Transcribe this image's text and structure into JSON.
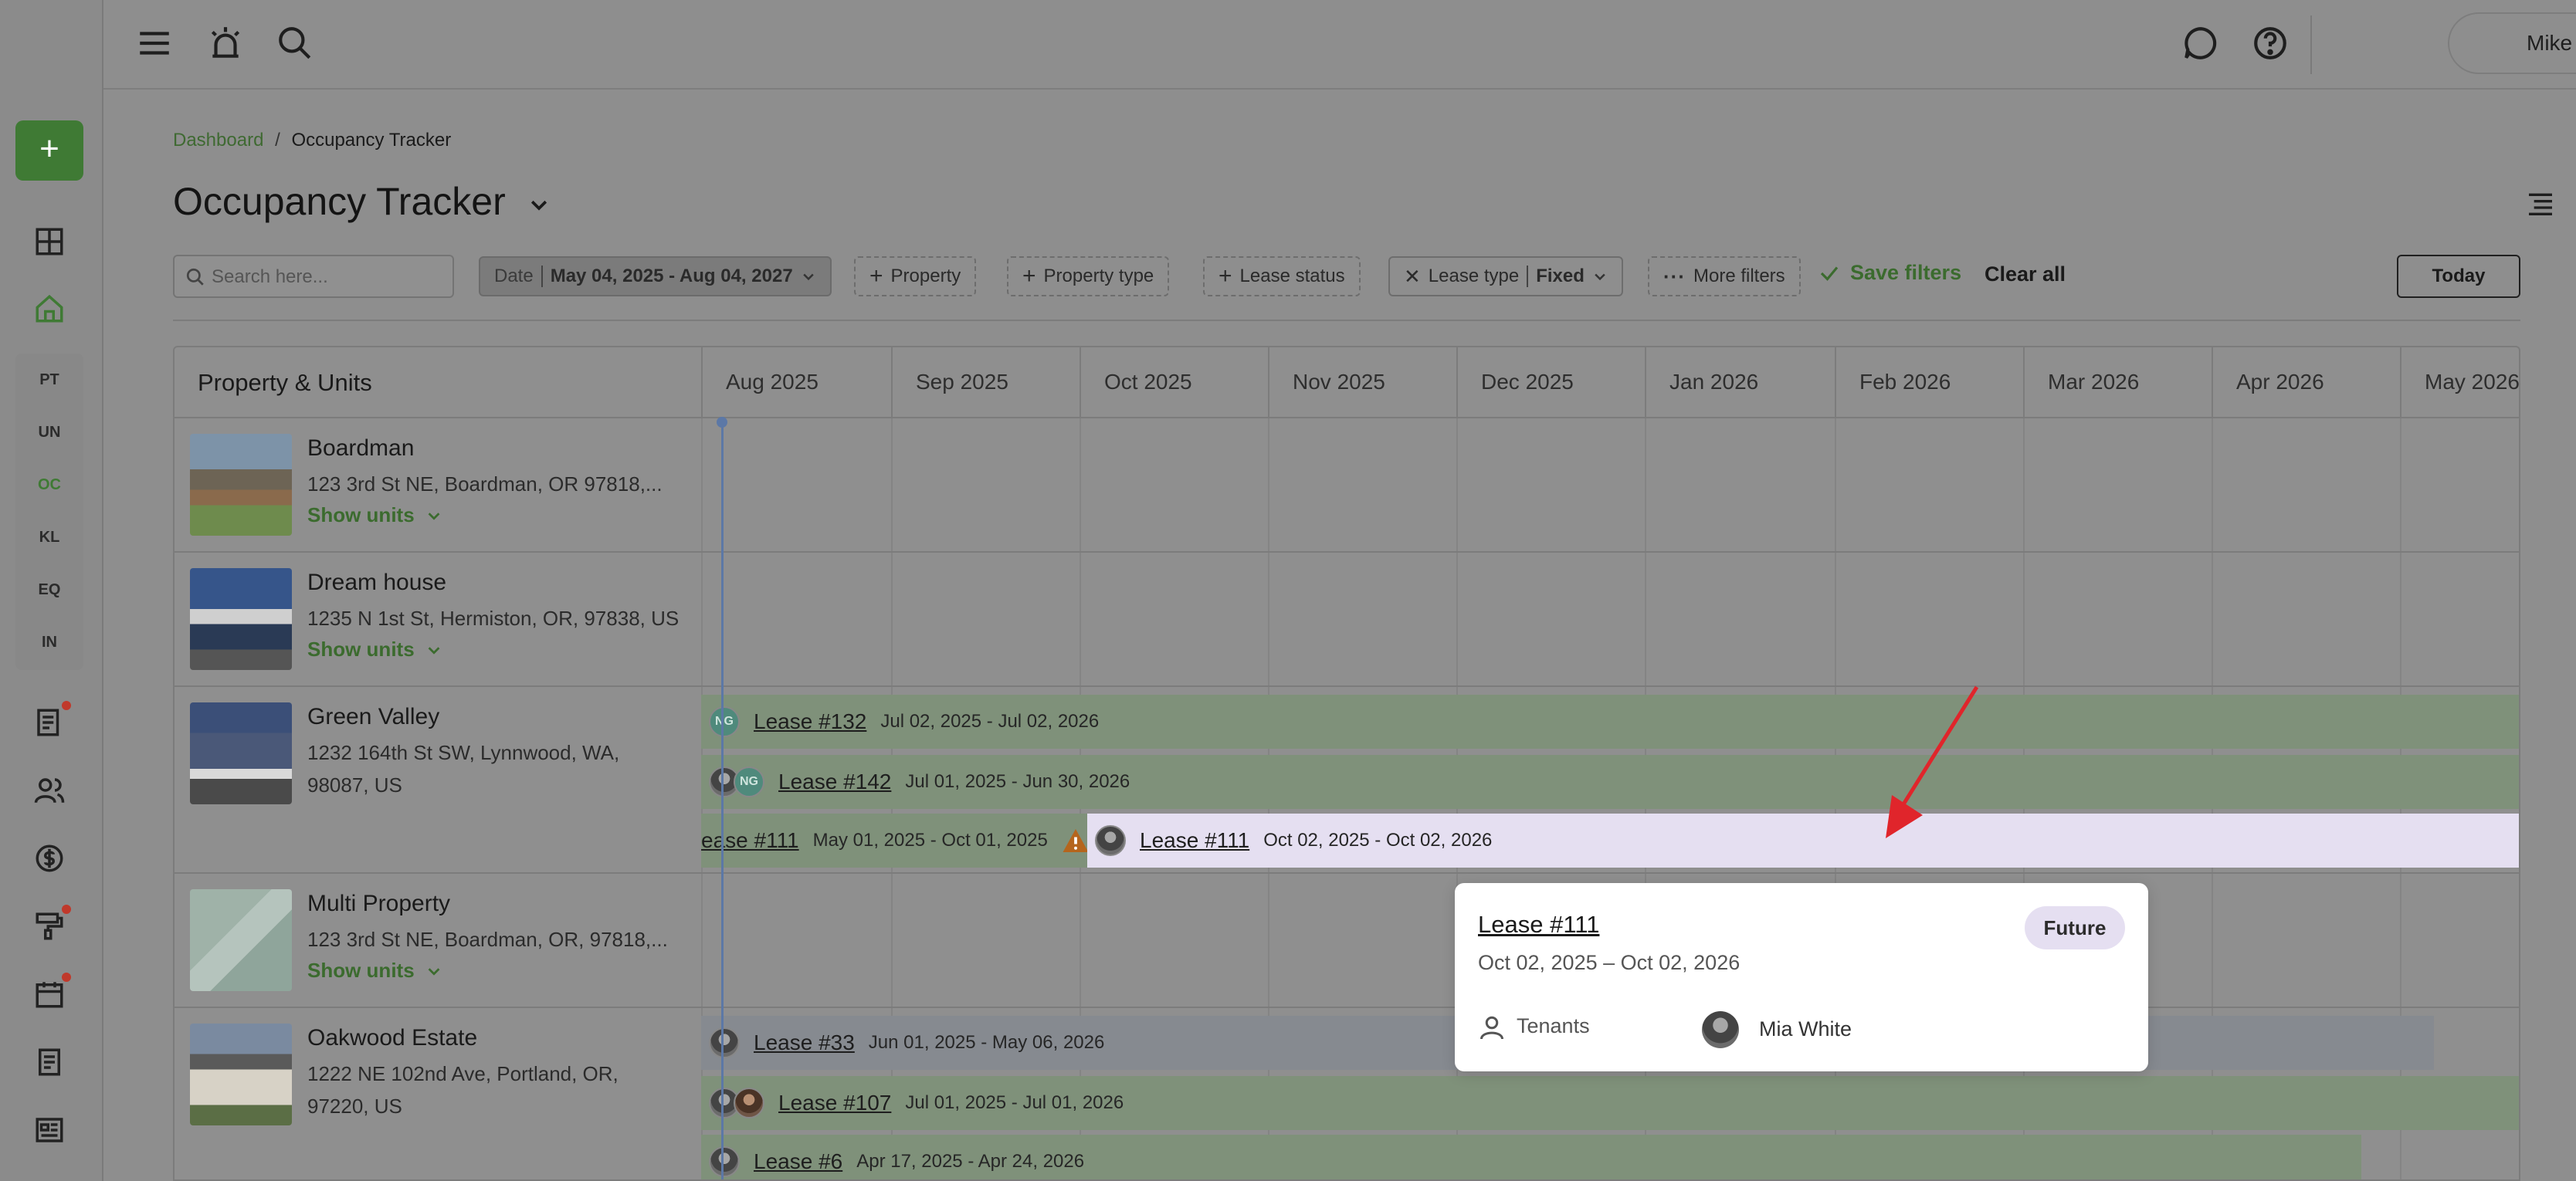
{
  "nav": {
    "add_label": "+",
    "abbrevs": [
      "PT",
      "UN",
      "OC",
      "KL",
      "EQ",
      "IN"
    ],
    "active_abbrev": "OC"
  },
  "topbar": {
    "user_name": "Mike"
  },
  "breadcrumb": {
    "home": "Dashboard",
    "separator": "/",
    "current": "Occupancy Tracker"
  },
  "page": {
    "title": "Occupancy Tracker"
  },
  "filters": {
    "search_placeholder": "Search here...",
    "date_label": "Date",
    "date_value": "May 04, 2025 - Aug 04, 2027",
    "property": "Property",
    "property_type": "Property type",
    "lease_status": "Lease status",
    "lease_type_label": "Lease type",
    "lease_type_value": "Fixed",
    "more_filters": "More filters",
    "save_filters": "Save filters",
    "clear_all": "Clear all",
    "today": "Today"
  },
  "grid": {
    "header": "Property & Units",
    "months": [
      "Aug 2025",
      "Sep 2025",
      "Oct 2025",
      "Nov 2025",
      "Dec 2025",
      "Jan 2026",
      "Feb 2026",
      "Mar 2026",
      "Apr 2026",
      "May 2026"
    ],
    "show_units": "Show units",
    "properties": [
      {
        "name": "Boardman",
        "address": "123 3rd St NE, Boardman, OR 97818,..."
      },
      {
        "name": "Dream house",
        "address": "1235 N 1st St, Hermiston, OR, 97838, US"
      },
      {
        "name": "Green Valley",
        "address_l1": "1232 164th St SW, Lynnwood, WA,",
        "address_l2": "98087, US"
      },
      {
        "name": "Multi Property",
        "address": "123 3rd St NE, Boardman, OR, 97818,..."
      },
      {
        "name": "Oakwood Estate",
        "address_l1": "1222 NE 102nd Ave, Portland, OR,",
        "address_l2": "97220, US"
      }
    ],
    "leases": {
      "l132": {
        "name": "Lease #132",
        "dates": "Jul 02, 2025 - Jul 02, 2026",
        "initials": "NG"
      },
      "l142": {
        "name": "Lease #142",
        "dates": "Jul 01, 2025 - Jun 30, 2026",
        "initials": "NG"
      },
      "l111a": {
        "name": "ease #111",
        "dates": "May 01, 2025 - Oct 01, 2025"
      },
      "l111b": {
        "name": "Lease #111",
        "dates": "Oct 02, 2025 - Oct 02, 2026"
      },
      "l33": {
        "name": "Lease #33",
        "dates": "Jun 01, 2025 - May 06, 2026"
      },
      "l107": {
        "name": "Lease #107",
        "dates": "Jul 01, 2025 - Jul 01, 2026"
      },
      "l6": {
        "name": "Lease #6",
        "dates": "Apr 17, 2025 - Apr 24, 2026"
      }
    }
  },
  "popup": {
    "lease": "Lease #111",
    "dates": "Oct 02, 2025 – Oct 02, 2026",
    "status": "Future",
    "tenants_label": "Tenants",
    "tenant_name": "Mia White"
  },
  "colors": {
    "accent_green": "#3f7a34",
    "future_badge": "#e5dff1",
    "annotation_arrow": "#e0252b"
  }
}
